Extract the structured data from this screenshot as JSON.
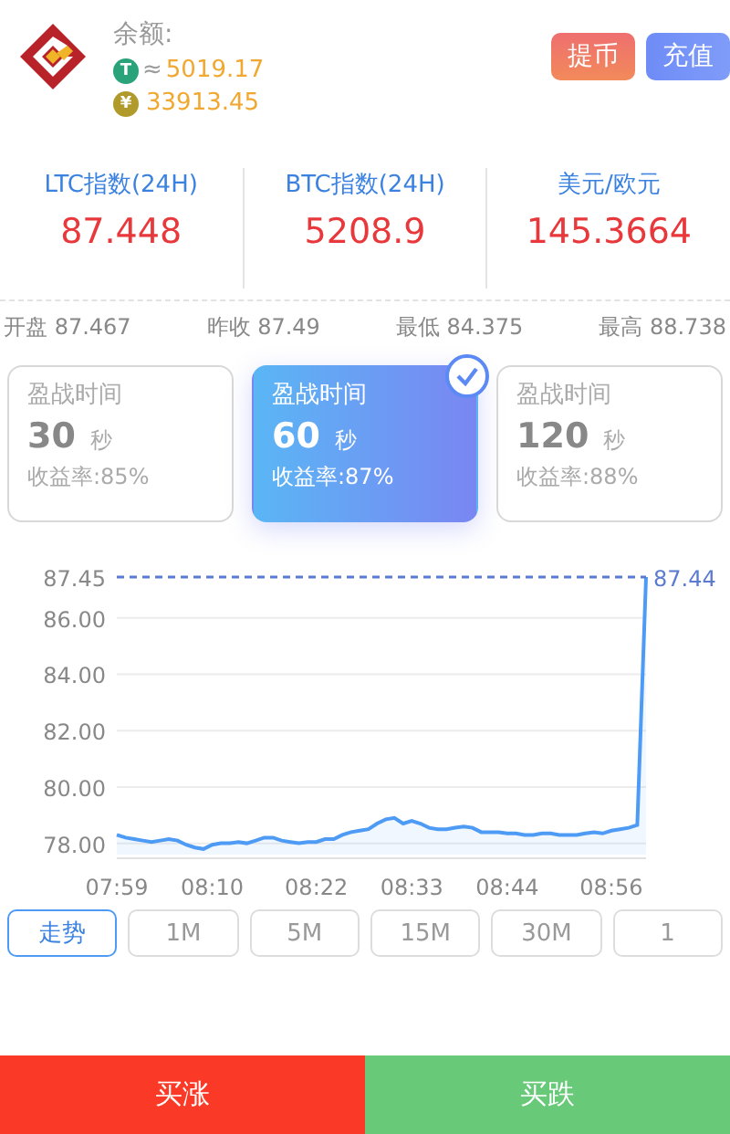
{
  "balance": {
    "label": "余额:",
    "items": [
      {
        "symbol": "T",
        "color": "#2aa37a",
        "approx": "≈",
        "amount": "5019.17"
      },
      {
        "symbol": "¥",
        "color": "#b09a2c",
        "amount": "33913.45"
      }
    ]
  },
  "actions": [
    {
      "label": "提币",
      "kind": "withdraw"
    },
    {
      "label": "充值",
      "kind": "deposit"
    }
  ],
  "indices": [
    {
      "name": "LTC指数(24H)",
      "value": "87.448"
    },
    {
      "name": "BTC指数(24H)",
      "value": "5208.9"
    },
    {
      "name": "美元/欧元",
      "value": "145.3664"
    }
  ],
  "stats": [
    "开盘 87.467",
    "昨收 87.49",
    "最低 84.375",
    "最高 88.738"
  ],
  "durations": [
    {
      "title": "盈战时间",
      "seconds": "30",
      "unit": "秒",
      "rate": "收益率:85%",
      "selected": false
    },
    {
      "title": "盈战时间",
      "seconds": "60",
      "unit": "秒",
      "rate": "收益率:87%",
      "selected": true
    },
    {
      "title": "盈战时间",
      "seconds": "120",
      "unit": "秒",
      "rate": "收益率:88%",
      "selected": false
    }
  ],
  "chart": {
    "last_price": "87.44",
    "chart_data": {
      "type": "area",
      "grid": true,
      "categories": [
        "07:59",
        null,
        null,
        null,
        null,
        null,
        null,
        null,
        null,
        null,
        null,
        "08:10",
        null,
        null,
        null,
        null,
        null,
        null,
        null,
        null,
        null,
        null,
        null,
        "08:22",
        null,
        null,
        null,
        null,
        null,
        null,
        null,
        null,
        null,
        null,
        "08:33",
        null,
        null,
        null,
        null,
        null,
        null,
        null,
        null,
        null,
        null,
        "08:44",
        null,
        null,
        null,
        null,
        null,
        null,
        null,
        null,
        null,
        null,
        null,
        "08:56",
        null,
        null,
        null,
        null
      ],
      "series": [
        {
          "color": "#4d9bf5",
          "values": [
            78.3,
            78.2,
            78.15,
            78.1,
            78.05,
            78.1,
            78.15,
            78.1,
            77.95,
            77.85,
            77.8,
            77.95,
            78.0,
            78.0,
            78.05,
            78.0,
            78.1,
            78.2,
            78.2,
            78.1,
            78.05,
            78.0,
            78.05,
            78.05,
            78.15,
            78.15,
            78.3,
            78.4,
            78.45,
            78.5,
            78.7,
            78.85,
            78.9,
            78.7,
            78.8,
            78.7,
            78.55,
            78.5,
            78.5,
            78.55,
            78.6,
            78.55,
            78.4,
            78.4,
            78.4,
            78.35,
            78.35,
            78.3,
            78.3,
            78.35,
            78.35,
            78.3,
            78.3,
            78.3,
            78.35,
            78.4,
            78.35,
            78.45,
            78.5,
            78.55,
            78.65,
            87.45
          ]
        }
      ],
      "ylim": [
        77.6,
        87.45
      ],
      "yticks": [
        {
          "value": 78,
          "label": "78.00"
        },
        {
          "value": 80,
          "label": "80.00"
        },
        {
          "value": 82,
          "label": "82.00"
        },
        {
          "value": 84,
          "label": "84.00"
        },
        {
          "value": 86,
          "label": "86.00"
        },
        {
          "value": 87.45,
          "label": "87.45"
        }
      ]
    }
  },
  "timeframes": [
    {
      "label": "走势",
      "selected": true
    },
    {
      "label": "1M",
      "selected": false
    },
    {
      "label": "5M",
      "selected": false
    },
    {
      "label": "15M",
      "selected": false
    },
    {
      "label": "30M",
      "selected": false
    },
    {
      "label": "1",
      "selected": false
    }
  ],
  "trade": [
    {
      "label": "买涨",
      "kind": "up"
    },
    {
      "label": "买跌",
      "kind": "down"
    }
  ]
}
